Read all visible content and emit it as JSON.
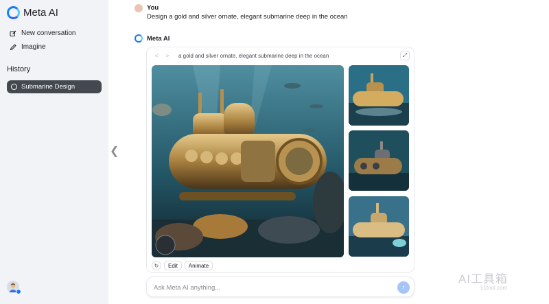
{
  "sidebar": {
    "app_name": "Meta AI",
    "nav": [
      {
        "label": "New conversation",
        "icon": "edit-icon"
      },
      {
        "label": "Imagine",
        "icon": "pencil-icon"
      }
    ],
    "history_title": "History",
    "history_items": [
      {
        "label": "Submarine Design",
        "icon": "chat-bubble-icon"
      }
    ]
  },
  "chat": {
    "user_name": "You",
    "user_message": "Design a gold and silver ornate, elegant submarine deep in the ocean",
    "assistant_name": "Meta AI",
    "card": {
      "prompt": "a gold and silver ornate, elegant submarine deep in the ocean",
      "actions": {
        "edit": "Edit",
        "animate": "Animate"
      }
    }
  },
  "composer": {
    "placeholder": "Ask Meta AI anything..."
  },
  "watermark": {
    "main": "AI工具箱",
    "sub": "51tool.com"
  },
  "colors": {
    "brand": "#1877f2",
    "history_active": "#444950",
    "send": "#a6c5f7"
  }
}
